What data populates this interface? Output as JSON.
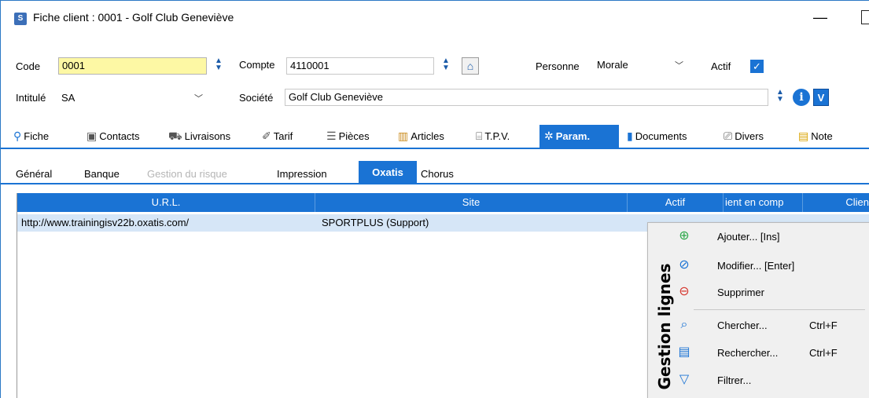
{
  "window": {
    "title": "Fiche client : 0001 - Golf Club Geneviève",
    "min_glyph": "—",
    "app_icon": "S"
  },
  "header": {
    "code_label": "Code",
    "code_value": "0001",
    "compte_label": "Compte",
    "compte_value": "4110001",
    "personne_label": "Personne",
    "personne_value": "Morale",
    "actif_label": "Actif",
    "actif_checked": true,
    "intitule_label": "Intitulé",
    "intitule_value": "SA",
    "societe_label": "Société",
    "societe_value": "Golf Club Geneviève"
  },
  "main_tabs": [
    {
      "label": "Fiche",
      "icon": "person-icon",
      "glyph": "⚲"
    },
    {
      "label": "Contacts",
      "icon": "contacts-icon",
      "glyph": "▣"
    },
    {
      "label": "Livraisons",
      "icon": "truck-icon",
      "glyph": "⛟"
    },
    {
      "label": "Tarif",
      "icon": "tag-icon",
      "glyph": "✐"
    },
    {
      "label": "Pièces",
      "icon": "document-list-icon",
      "glyph": "☰"
    },
    {
      "label": "Articles",
      "icon": "box-icon",
      "glyph": "▥"
    },
    {
      "label": "T.P.V.",
      "icon": "register-icon",
      "glyph": "⌸"
    },
    {
      "label": "Param.",
      "icon": "gear-icon",
      "glyph": "✲",
      "active": true
    },
    {
      "label": "Documents",
      "icon": "bar-chart-icon",
      "glyph": "▮"
    },
    {
      "label": "Divers",
      "icon": "monitor-icon",
      "glyph": "⎚"
    },
    {
      "label": "Note",
      "icon": "note-icon",
      "glyph": "▤"
    }
  ],
  "sub_tabs": [
    {
      "label": "Général"
    },
    {
      "label": "Banque"
    },
    {
      "label": "Gestion du risque",
      "disabled": true
    },
    {
      "label": "Impression"
    },
    {
      "label": "Oxatis",
      "active": true
    },
    {
      "label": "Chorus"
    }
  ],
  "grid": {
    "columns": [
      "U.R.L.",
      "Site",
      "Actif",
      "ient en comp",
      "Clien"
    ],
    "rows": [
      {
        "url": "http://www.trainingisv22b.oxatis.com/",
        "site": "SPORTPLUS (Support)"
      }
    ]
  },
  "context_menu": {
    "side_label": "Gestion lignes",
    "items": [
      {
        "label": "Ajouter... [Ins]",
        "shortcut": "",
        "icon": "plus-circle-icon",
        "glyph": "⊕"
      },
      {
        "label": "Modifier... [Enter]",
        "shortcut": "",
        "icon": "edit-circle-icon",
        "glyph": "⊘"
      },
      {
        "label": "Supprimer",
        "shortcut": "",
        "icon": "minus-circle-icon",
        "glyph": "⊖"
      },
      {
        "label": "Chercher...",
        "shortcut": "Ctrl+F",
        "icon": "search-icon",
        "glyph": "⌕"
      },
      {
        "label": "Rechercher...",
        "shortcut": "Ctrl+F",
        "icon": "advanced-search-icon",
        "glyph": "▤"
      },
      {
        "label": "Filtrer...",
        "shortcut": "",
        "icon": "filter-icon",
        "glyph": "▽"
      }
    ]
  },
  "colors": {
    "accent": "#1a73d4",
    "code_field_bg": "#fdf8a4",
    "row_selected": "#d6e6f7"
  }
}
